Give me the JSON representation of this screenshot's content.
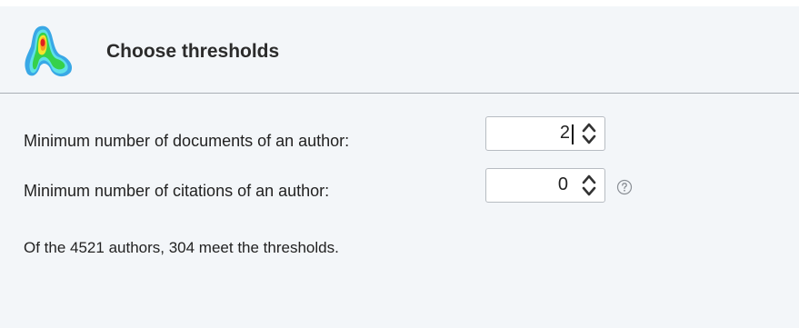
{
  "dialog": {
    "title": "Choose thresholds",
    "logo_icon": "density-map-icon"
  },
  "fields": {
    "min_documents": {
      "label": "Minimum number of documents of an author:",
      "value": "2"
    },
    "min_citations": {
      "label": "Minimum number of citations of an author:",
      "value": "0",
      "help_icon": "help-icon"
    }
  },
  "summary": "Of the 4521 authors, 304 meet the thresholds.",
  "colors": {
    "header_bg": "#f3f6f9",
    "divider": "#a9afb6",
    "logo_green": "#2ecc40",
    "logo_red": "#e02020"
  }
}
